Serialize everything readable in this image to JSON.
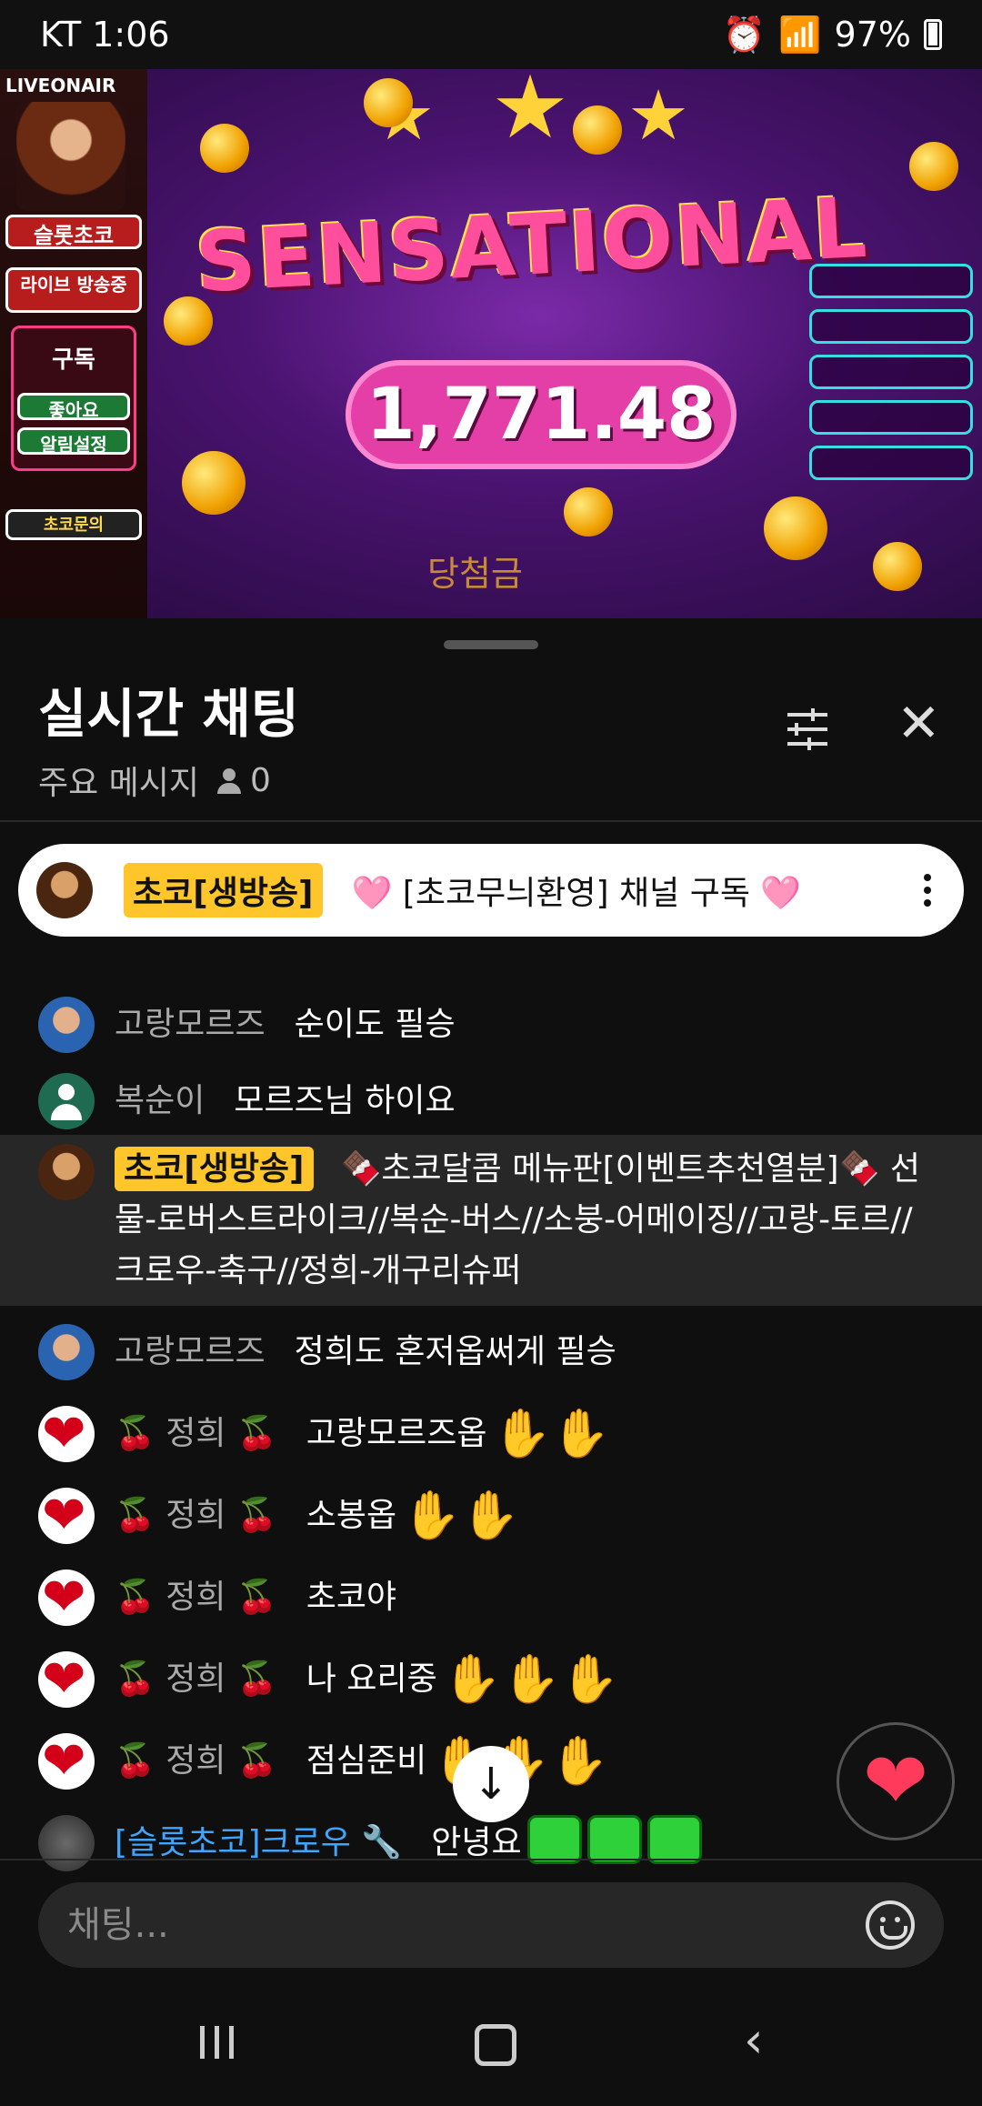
{
  "status_bar": {
    "carrier_time": "KT 1:06",
    "battery": "97%"
  },
  "video": {
    "channel_logo": "LIVEONAIR",
    "sidebar_badges": [
      "슬롯초코",
      "라이브 방송중",
      "구독",
      "좋아요",
      "알림설정",
      "초코문의"
    ],
    "game_banner": "SENSATIONAL",
    "win_amount": "1,771.48",
    "win_label": "당첨금"
  },
  "chat": {
    "title": "실시간 채팅",
    "subtitle": "주요 메시지",
    "viewer_count": "0",
    "pinned": {
      "badge": "초코[생방송]",
      "message": "🩷 [초코무늬환영] 채널 구독 🩷"
    },
    "messages": [
      {
        "name": "고랑모르즈",
        "text": "순이도 필승"
      },
      {
        "name": "복순이",
        "text": "모르즈님 하이요"
      },
      {
        "name": "초코[생방송]",
        "text": "🍫초코달콤 메뉴판[이벤트추천열분]🍫 선물-로버스트라이크//복순-버스//소붕-어메이징//고랑-토르//크로우-축구//정희-개구리슈퍼"
      },
      {
        "name": "고랑모르즈",
        "text": "정희도 혼저옵써게 필승"
      },
      {
        "name": "🍒 정희 🍒",
        "text": "고랑모르즈옵"
      },
      {
        "name": "🍒 정희 🍒",
        "text": "소봉옵"
      },
      {
        "name": "🍒 정희 🍒",
        "text": "초코야"
      },
      {
        "name": "🍒 정희 🍒",
        "text": "나 요리중"
      },
      {
        "name": "🍒 정희 🍒",
        "text": "점심준비"
      },
      {
        "name": "[슬롯초코]크로우 🔧",
        "text": "안녕요"
      }
    ],
    "input_placeholder": "채팅..."
  }
}
